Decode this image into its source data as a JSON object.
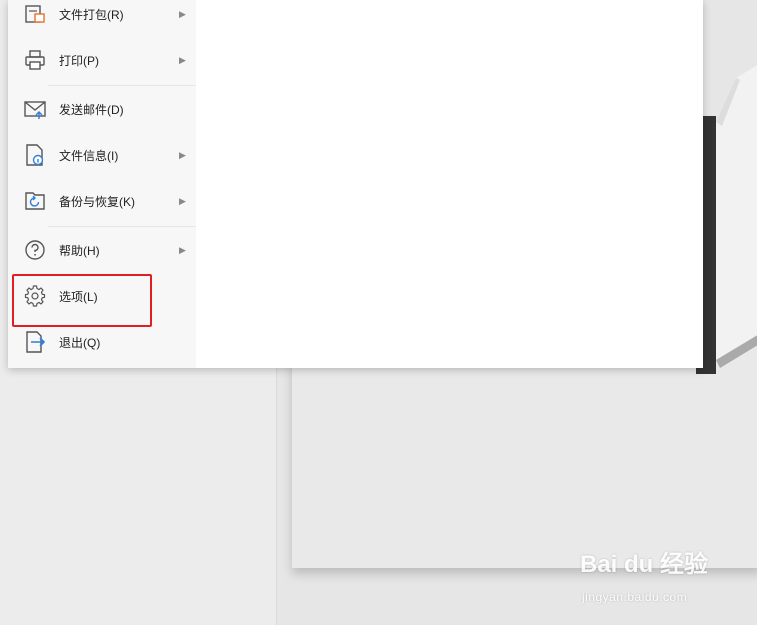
{
  "menu": {
    "items": [
      {
        "label": "文件打包(R)",
        "icon": "package-icon",
        "arrow": "▶"
      },
      {
        "label": "打印(P)",
        "icon": "printer-icon",
        "arrow": "▶"
      },
      {
        "label": "发送邮件(D)",
        "icon": "mail-icon"
      },
      {
        "label": "文件信息(I)",
        "icon": "file-info-icon",
        "arrow": "▶"
      },
      {
        "label": "备份与恢复(K)",
        "icon": "backup-restore-icon",
        "arrow": "▶"
      },
      {
        "label": "帮助(H)",
        "icon": "help-icon",
        "arrow": "▶"
      },
      {
        "label": "选项(L)",
        "icon": "gear-icon"
      },
      {
        "label": "退出(Q)",
        "icon": "exit-icon"
      }
    ],
    "highlight_color": "#e02020"
  },
  "watermark": {
    "brand": "Bai du 经验",
    "url": "jingyan.baidu.com"
  }
}
